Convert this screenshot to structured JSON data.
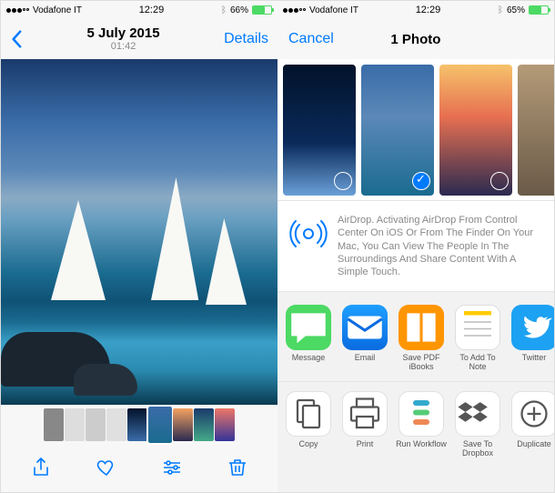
{
  "left": {
    "status": {
      "carrier": "Vodafone IT",
      "time": "12:29",
      "battery": "66%"
    },
    "nav": {
      "date": "5 July 2015",
      "time": "01:42",
      "details": "Details"
    },
    "thumbs": [
      {
        "bg": "#888"
      },
      {
        "bg": "#ddd"
      },
      {
        "bg": "#ccc"
      },
      {
        "bg": "#e0e0e0"
      },
      {
        "bg": "linear-gradient(#02122a,#3a6ca8)"
      },
      {
        "bg": "linear-gradient(#3a6ca8,#1a6b90)",
        "active": true
      },
      {
        "bg": "linear-gradient(#f4a261,#2a2a50)"
      },
      {
        "bg": "linear-gradient(#1a3a6b,#4a8)"
      },
      {
        "bg": "linear-gradient(#e76,#339)"
      }
    ],
    "toolbar": {
      "share": "share-icon",
      "favorite": "heart-icon",
      "edit": "sliders-icon",
      "delete": "trash-icon"
    }
  },
  "right": {
    "status": {
      "carrier": "Vodafone IT",
      "time": "12:29",
      "battery": "65%"
    },
    "nav": {
      "cancel": "Cancel",
      "count": "1 Photo"
    },
    "thumbs": [
      {
        "bg": "linear-gradient(#02122a 0%,#0a2a5a 60%,#6aa0d8 100%)"
      },
      {
        "bg": "linear-gradient(#3a6ca8 0%,#5b88b8 40%,#1a6b90 100%)",
        "selected": true
      },
      {
        "bg": "linear-gradient(#f6c26b 0%,#e76f51 40%,#2a2a50 100%)"
      },
      {
        "bg": "linear-gradient(#b49a78,#6a5a48)"
      }
    ],
    "airdrop": "AirDrop. Activating AirDrop From Control Center On iOS Or From The Finder On Your Mac, You Can View The People In The Surroundings And Share Content With A Simple Touch.",
    "share": [
      {
        "key": "message",
        "label": "Message",
        "cls": "ic-msg"
      },
      {
        "key": "email",
        "label": "Email",
        "cls": "ic-mail"
      },
      {
        "key": "ibooks",
        "label": "Save PDF iBooks",
        "cls": "ic-ibooks"
      },
      {
        "key": "notes",
        "label": "To Add To Note",
        "cls": "ic-notes"
      },
      {
        "key": "twitter",
        "label": "Twitter",
        "cls": "ic-twitter"
      }
    ],
    "actions": [
      {
        "key": "copy",
        "label": "Copy"
      },
      {
        "key": "print",
        "label": "Print"
      },
      {
        "key": "workflow",
        "label": "Run Workflow"
      },
      {
        "key": "dropbox",
        "label": "Save To Dropbox"
      },
      {
        "key": "duplicate",
        "label": "Duplicate"
      }
    ]
  }
}
